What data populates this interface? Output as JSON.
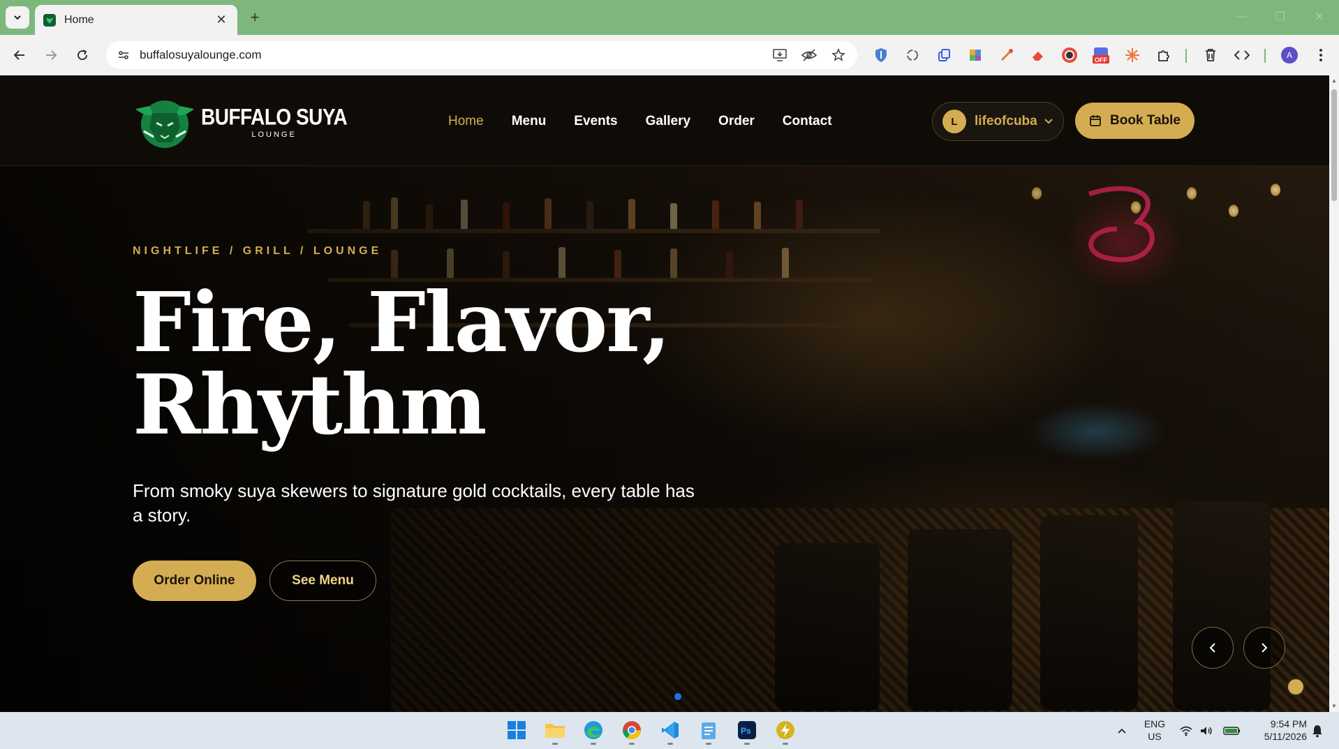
{
  "browser": {
    "tab_title": "Home",
    "url": "buffalosuyalounge.com",
    "extension_badge": "OFF",
    "profile_initial": "A"
  },
  "site": {
    "logo_name": "BUFFALO SUYA",
    "logo_sub": "LOUNGE",
    "nav": [
      "Home",
      "Menu",
      "Events",
      "Gallery",
      "Order",
      "Contact"
    ],
    "active_nav": "Home",
    "user_initial": "L",
    "user_name": "lifeofcuba",
    "book_button": "Book Table"
  },
  "hero": {
    "eyebrow": "NIGHTLIFE / GRILL / LOUNGE",
    "title_line1": "Fire, Flavor,",
    "title_line2": "Rhythm",
    "copy": "From smoky suya skewers to signature gold cocktails, every table has a story.",
    "primary_button": "Order Online",
    "secondary_button": "See Menu",
    "slide_count": 1
  },
  "taskbar": {
    "lang_line1": "ENG",
    "lang_line2": "US",
    "time": "9:54 PM",
    "date": "5/11/2026"
  },
  "colors": {
    "accent_gold": "#d4ad52",
    "chrome_green": "#7db77c"
  }
}
